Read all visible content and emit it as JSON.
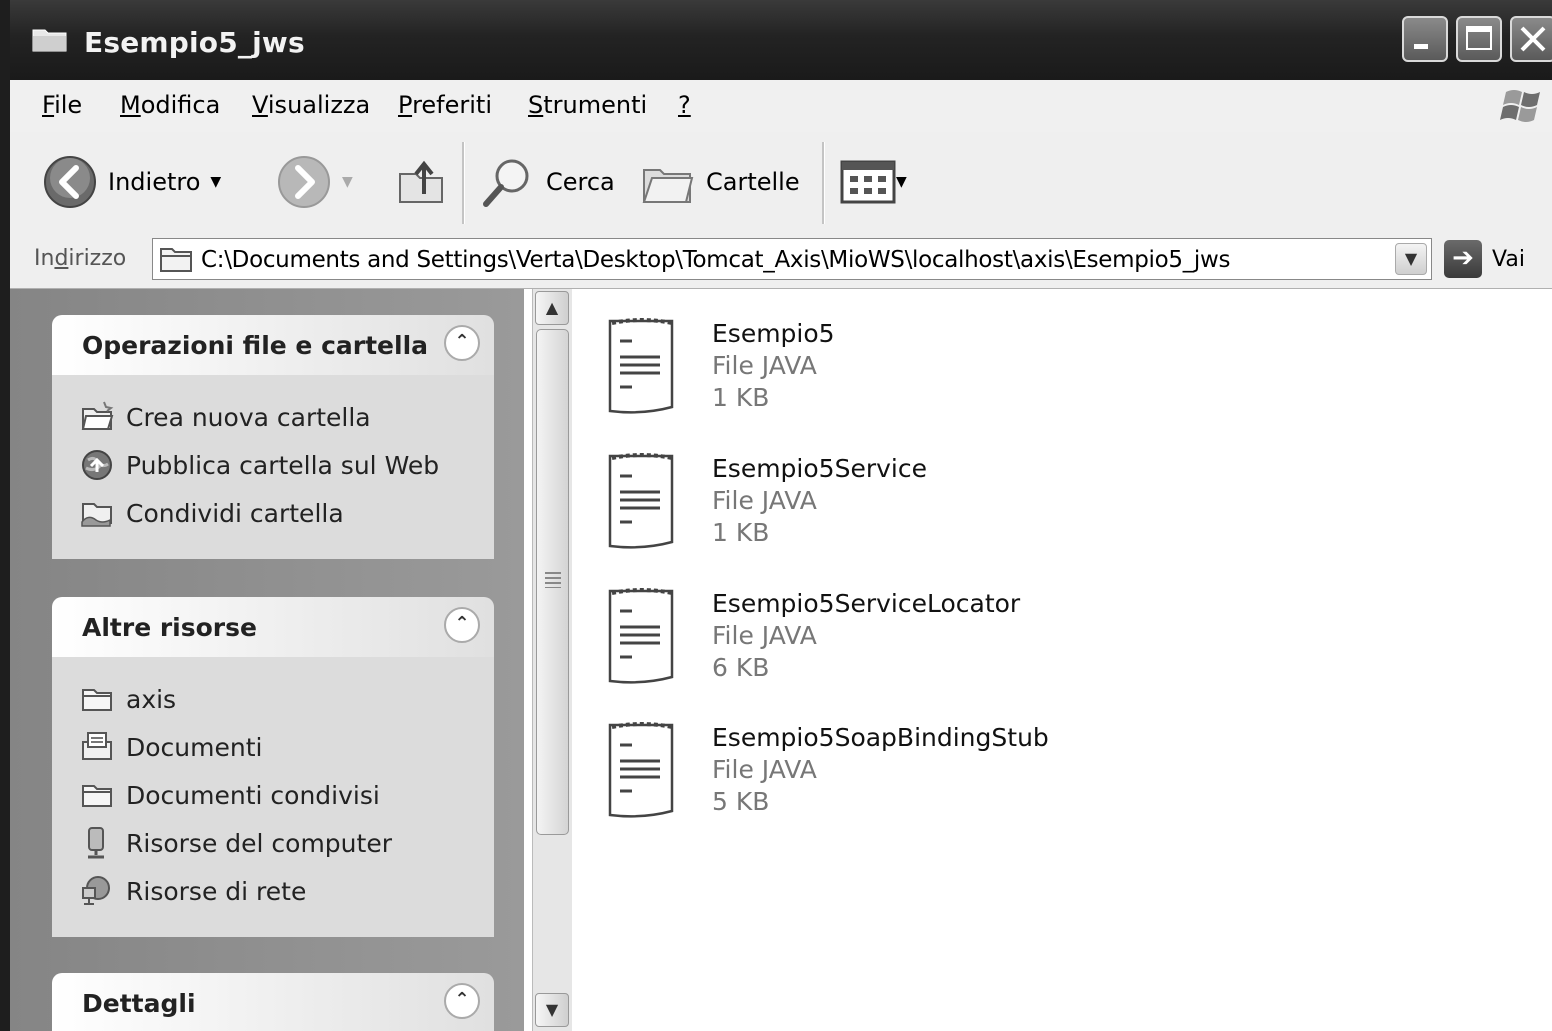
{
  "window": {
    "title": "Esempio5_jws"
  },
  "menu": {
    "items": [
      {
        "mnemonic": "F",
        "rest": "ile"
      },
      {
        "mnemonic": "M",
        "rest": "odifica"
      },
      {
        "mnemonic": "V",
        "rest": "isualizza"
      },
      {
        "mnemonic": "P",
        "rest": "referiti"
      },
      {
        "mnemonic": "S",
        "rest": "trumenti"
      },
      {
        "mnemonic": "?",
        "rest": ""
      }
    ]
  },
  "toolbar": {
    "back_label": "Indietro",
    "search_label": "Cerca",
    "folders_label": "Cartelle"
  },
  "address": {
    "label_pre": "In",
    "label_mnemonic": "d",
    "label_post": "irizzo",
    "path": "C:\\Documents and Settings\\Verta\\Desktop\\Tomcat_Axis\\MioWS\\localhost\\axis\\Esempio5_jws",
    "go_label": "Vai"
  },
  "taskpane": {
    "file_tasks": {
      "title": "Operazioni file e cartella",
      "items": [
        "Crea nuova cartella",
        "Pubblica cartella sul Web",
        "Condividi cartella"
      ]
    },
    "other_places": {
      "title": "Altre risorse",
      "items": [
        "axis",
        "Documenti",
        "Documenti condivisi",
        "Risorse del computer",
        "Risorse di rete"
      ]
    },
    "details": {
      "title": "Dettagli"
    }
  },
  "files": [
    {
      "name": "Esempio5",
      "type": "File JAVA",
      "size": "1 KB"
    },
    {
      "name": "Esempio5Service",
      "type": "File JAVA",
      "size": "1 KB"
    },
    {
      "name": "Esempio5ServiceLocator",
      "type": "File JAVA",
      "size": "6 KB"
    },
    {
      "name": "Esempio5SoapBindingStub",
      "type": "File JAVA",
      "size": "5 KB"
    }
  ]
}
